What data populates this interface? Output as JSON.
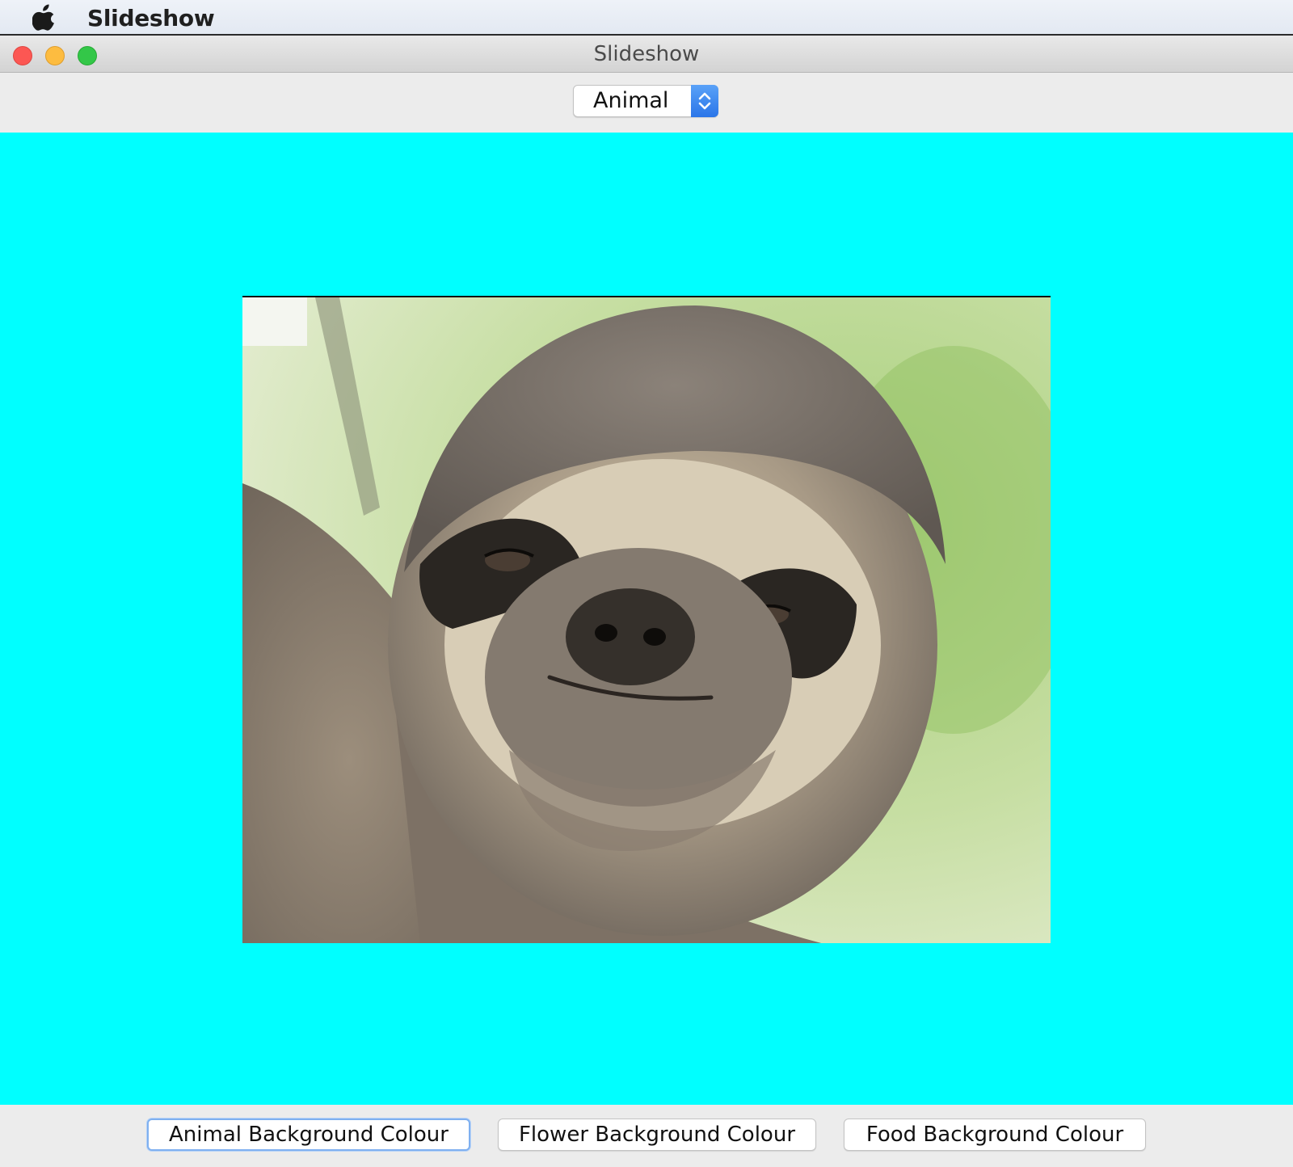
{
  "menubar": {
    "app_name": "Slideshow",
    "icon": "apple-icon"
  },
  "window": {
    "title": "Slideshow",
    "buttons": [
      "close-button",
      "minimize-button",
      "zoom-button"
    ]
  },
  "toolbar": {
    "category_select": {
      "selected": "Animal",
      "icon": "up-down-chevron-icon"
    }
  },
  "slide": {
    "background_color": "#00ffff",
    "image_subject": "sloth-photo"
  },
  "buttons": {
    "animal_bg": "Animal Background Colour",
    "flower_bg": "Flower Background Colour",
    "food_bg": "Food Background Colour"
  }
}
